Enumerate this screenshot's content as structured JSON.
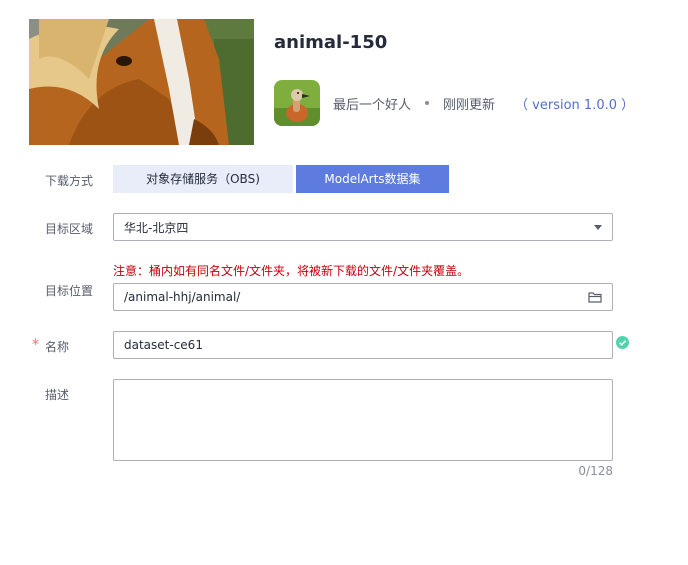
{
  "dataset": {
    "title": "animal-150",
    "author": "最后一个好人",
    "updated": "刚刚更新",
    "version": "（ version 1.0.0 ）"
  },
  "form": {
    "download_label": "下载方式",
    "tab_obs": "对象存储服务（OBS)",
    "tab_modelarts": "ModelArts数据集",
    "region_label": "目标区域",
    "region_value": "华北-北京四",
    "location_label": "目标位置",
    "location_warning": "注意：桶内如有同名文件/文件夹，将被新下载的文件/文件夹覆盖。",
    "location_value": "/animal-hhj/animal/",
    "required_mark": "*",
    "name_label": "名称",
    "name_value": "dataset-ce61",
    "desc_label": "描述",
    "desc_counter": "0/128"
  },
  "icons": {
    "cover": "horse-photo",
    "avatar": "duck-avatar",
    "region_caret": "caret-down-icon",
    "folder": "folder-icon",
    "valid": "check-circle-icon"
  },
  "colors": {
    "primary": "#5e7ce0",
    "tab_inactive": "#e9edfa",
    "warning_text": "#c7000b",
    "success": "#50d4ab",
    "link": "#526ecc"
  }
}
